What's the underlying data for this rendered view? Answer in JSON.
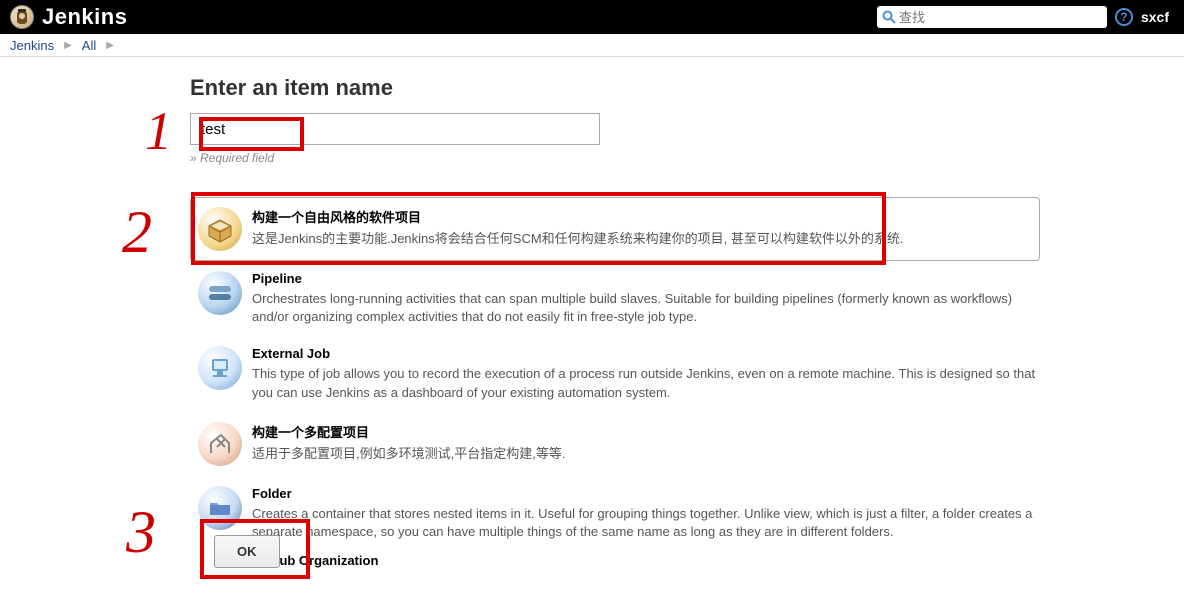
{
  "header": {
    "logo_text": "Jenkins",
    "search_placeholder": "查找",
    "help_label": "?",
    "user": "sxcf"
  },
  "breadcrumb": {
    "items": [
      "Jenkins",
      "All"
    ]
  },
  "annotations": {
    "one": "1",
    "two": "2",
    "three": "3"
  },
  "main": {
    "title": "Enter an item name",
    "name_value": "test",
    "name_hint": "» Required field"
  },
  "items": [
    {
      "title": "构建一个自由风格的软件项目",
      "desc": "这是Jenkins的主要功能.Jenkins将会结合任何SCM和任何构建系统来构建你的项目, 甚至可以构建软件以外的系统."
    },
    {
      "title": "Pipeline",
      "desc": "Orchestrates long-running activities that can span multiple build slaves. Suitable for building pipelines (formerly known as workflows) and/or organizing complex activities that do not easily fit in free-style job type."
    },
    {
      "title": "External Job",
      "desc": "This type of job allows you to record the execution of a process run outside Jenkins, even on a remote machine. This is designed so that you can use Jenkins as a dashboard of your existing automation system."
    },
    {
      "title": "构建一个多配置项目",
      "desc": "适用于多配置项目,例如多环境测试,平台指定构建,等等."
    },
    {
      "title": "Folder",
      "desc": "Creates a container that stores nested items in it. Useful for grouping things together. Unlike view, which is just a filter, a folder creates a separate namespace, so you can have multiple things of the same name as long as they are in different folders."
    },
    {
      "title": "GitHub Organization",
      "desc": ""
    }
  ],
  "footer": {
    "ok_label": "OK"
  }
}
